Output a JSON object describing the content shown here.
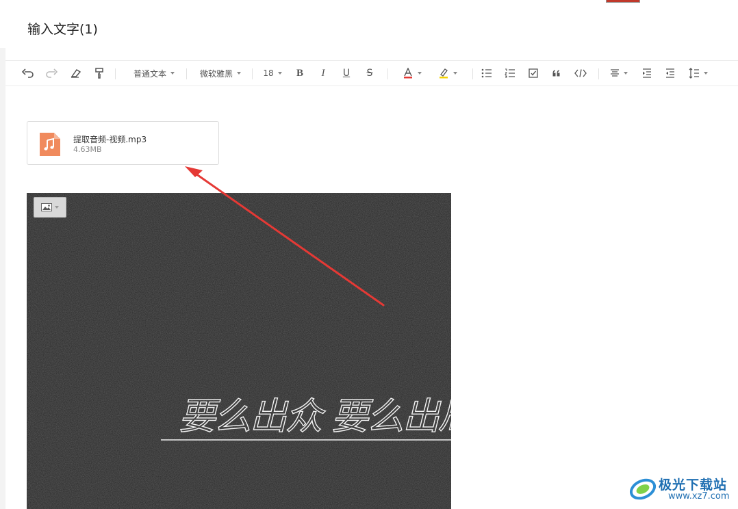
{
  "document": {
    "title": "输入文字(1)"
  },
  "toolbar": {
    "paragraph_style": "普通文本",
    "font_family": "微软雅黑",
    "font_size": "18",
    "buttons": [
      "undo-icon",
      "redo-icon",
      "eraser-icon",
      "format-painter-icon",
      "bold-icon",
      "italic-icon",
      "underline-icon",
      "strikethrough-icon",
      "font-color-icon",
      "highlight-icon",
      "bullet-list-icon",
      "numbered-list-icon",
      "checklist-icon",
      "quote-icon",
      "code-icon",
      "align-icon",
      "indent-icon",
      "outdent-icon",
      "line-height-icon"
    ],
    "font_color": "#e53935",
    "highlight_color": "#f5d300"
  },
  "attachment": {
    "file_name": "提取音频-视频.mp3",
    "file_size": "4.63MB",
    "icon": "music-file-icon",
    "icon_color": "#f08a5d"
  },
  "image": {
    "menu_icon": "image-icon",
    "overlay_text": "要么出众 要么出局"
  },
  "annotation": {
    "arrow_color": "#e53935"
  },
  "watermark": {
    "name": "极光下载站",
    "url": "www.xz7.com"
  }
}
